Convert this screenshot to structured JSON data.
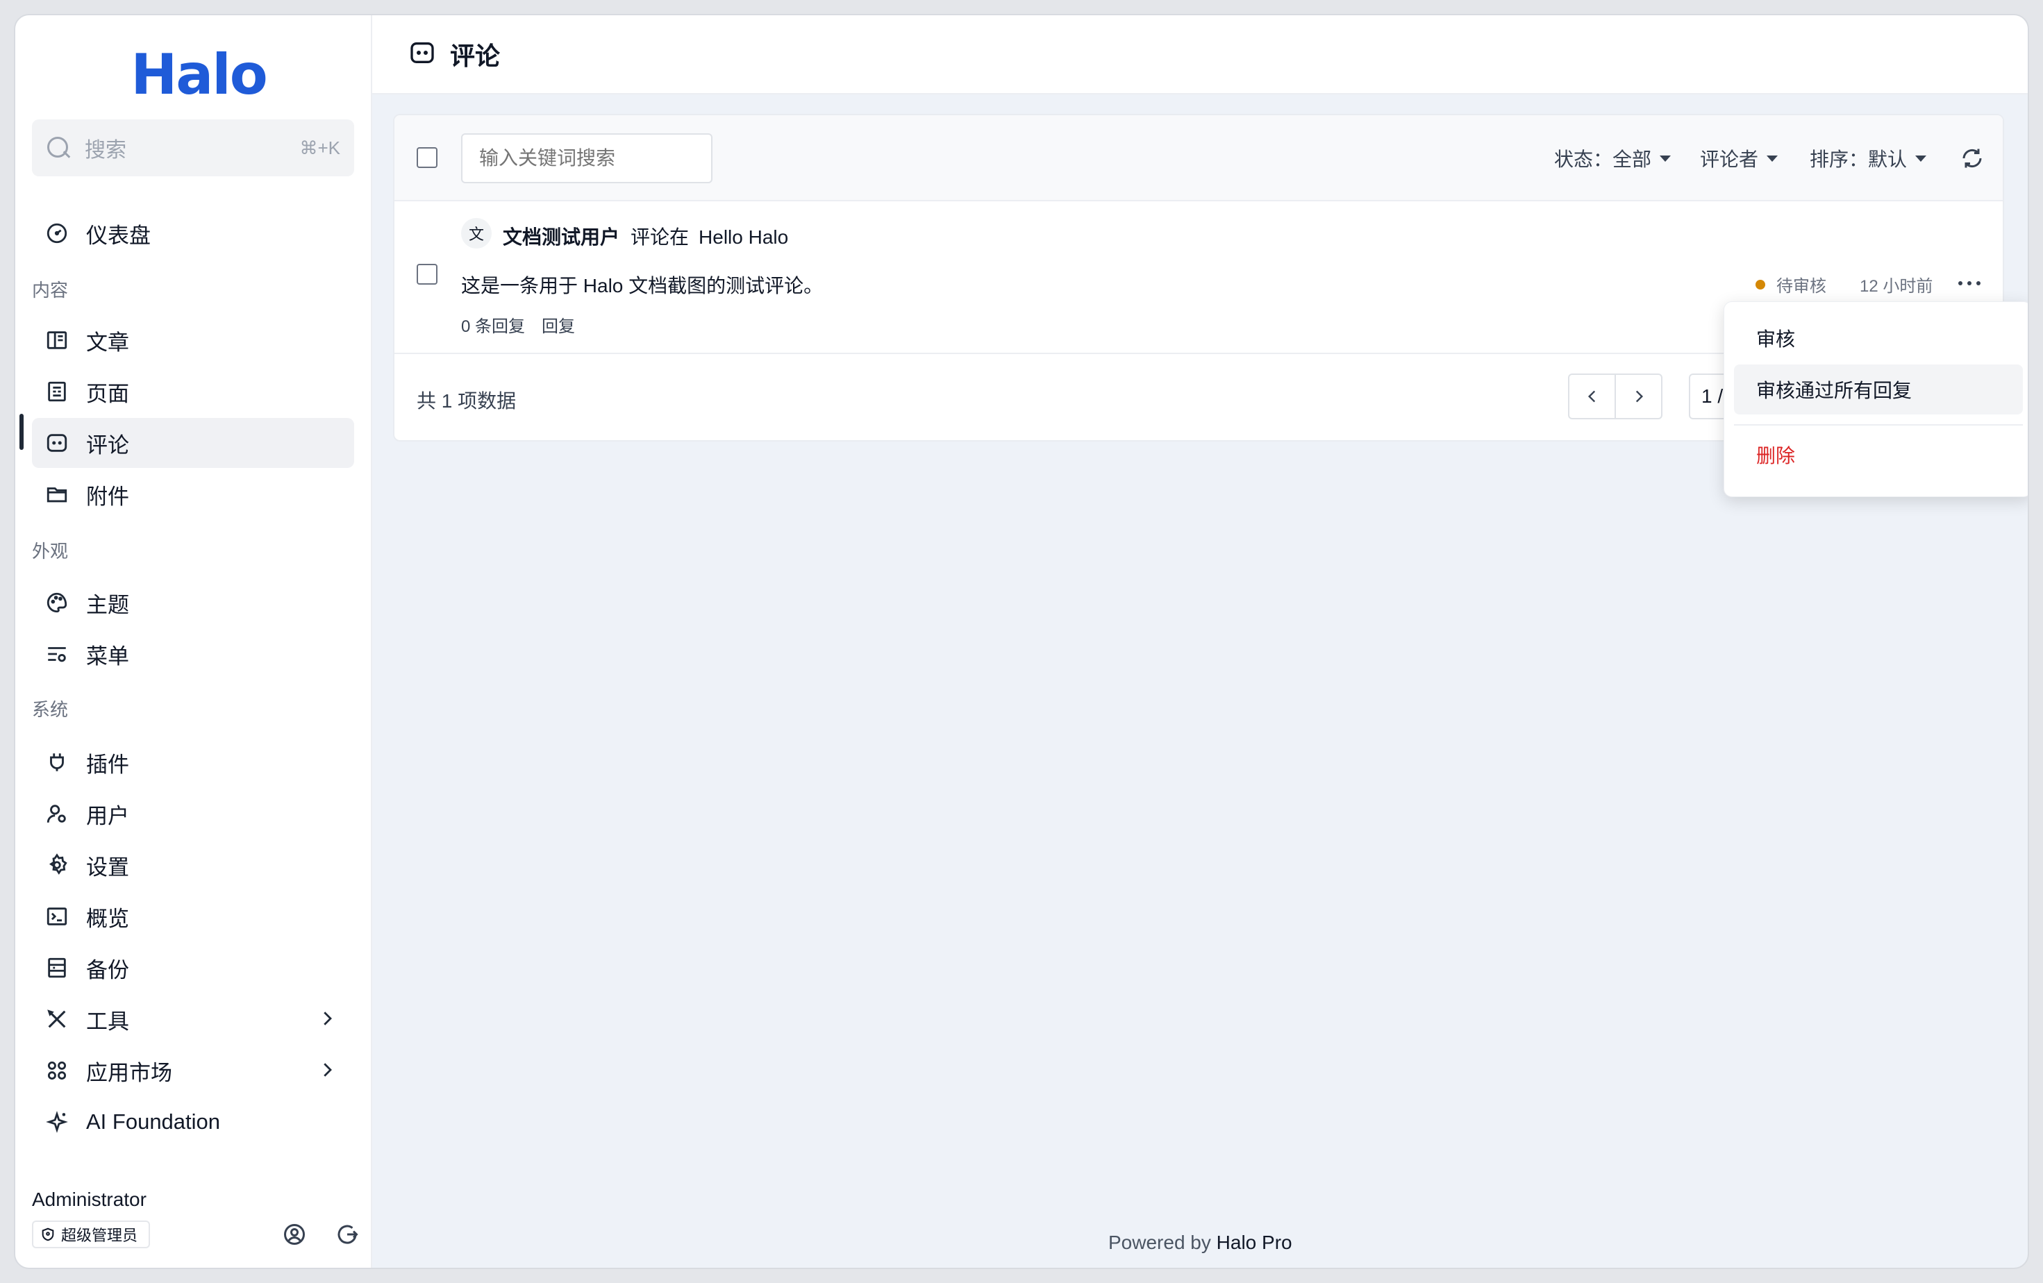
{
  "app": {
    "logo_text": "Halo"
  },
  "search": {
    "placeholder": "搜索",
    "shortcut": "⌘+K"
  },
  "nav": {
    "dashboard": "仪表盘",
    "section_content": "内容",
    "posts": "文章",
    "pages": "页面",
    "comments": "评论",
    "attachments": "附件",
    "section_appearance": "外观",
    "themes": "主题",
    "menus": "菜单",
    "section_system": "系统",
    "plugins": "插件",
    "users": "用户",
    "settings": "设置",
    "overview": "概览",
    "backup": "备份",
    "tools": "工具",
    "app_market": "应用市场",
    "ai_foundation": "AI Foundation"
  },
  "user": {
    "name": "Administrator",
    "role": "超级管理员"
  },
  "header": {
    "title": "评论"
  },
  "toolbar": {
    "keyword_placeholder": "输入关键词搜索",
    "filter_status": "状态：全部",
    "filter_commenter": "评论者",
    "filter_sort": "排序：默认"
  },
  "comments": [
    {
      "avatar_char": "文",
      "author": "文档测试用户",
      "action": "评论在",
      "post_title": "Hello Halo",
      "content": "这是一条用于 Halo 文档截图的测试评论。",
      "reply_count": "0 条回复",
      "reply_label": "回复",
      "status": "待审核",
      "status_color": "#d48806",
      "time": "12 小时前"
    }
  ],
  "pagination": {
    "total": "共 1 项数据",
    "page_info": "1 / 1"
  },
  "menu": {
    "approve": "审核",
    "approve_all_replies": "审核通过所有回复",
    "delete": "删除"
  },
  "footer": {
    "powered_prefix": "Powered by",
    "powered_brand": "Halo Pro"
  },
  "colors": {
    "brand": "#1f5bd8",
    "danger": "#dc2626",
    "pending": "#d48806"
  }
}
